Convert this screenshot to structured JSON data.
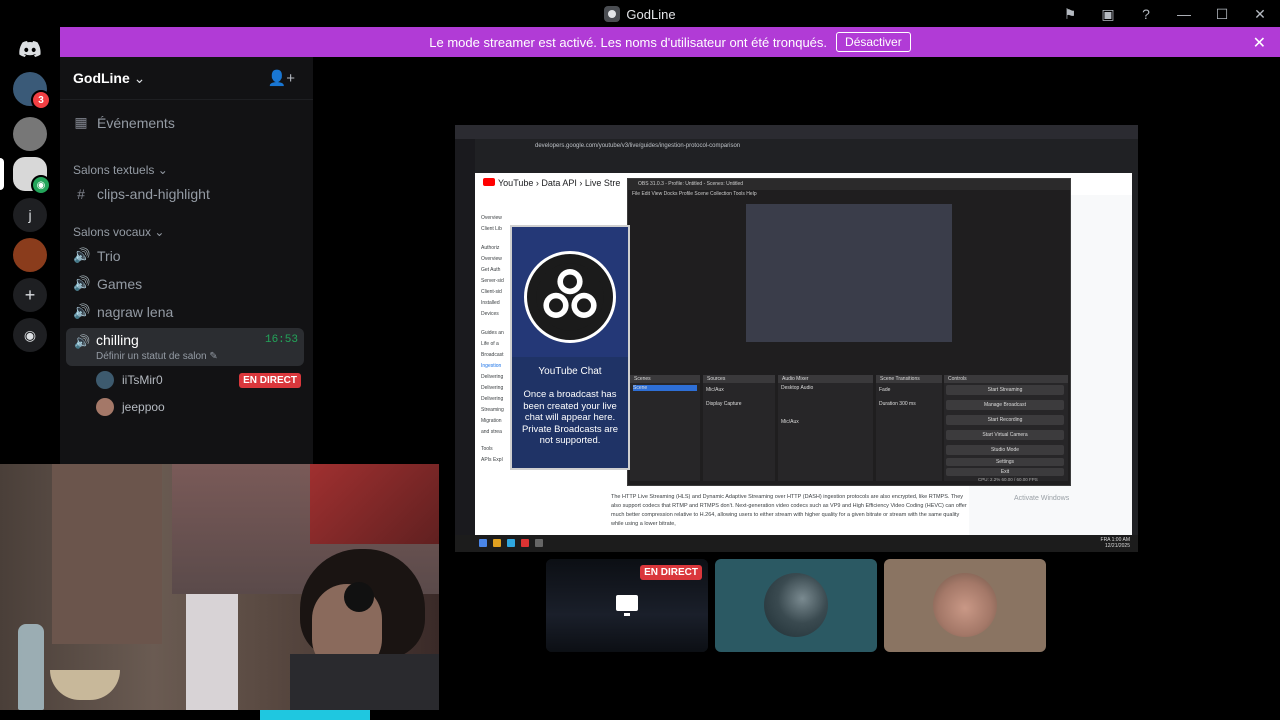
{
  "app": {
    "title": "GodLine"
  },
  "titlebar_icons": [
    "inbox-flag-icon",
    "monitor-icon",
    "help-icon",
    "minimize-icon",
    "maximize-icon",
    "close-icon"
  ],
  "server_rail": {
    "items": [
      {
        "name": "discord-home",
        "badge": ""
      },
      {
        "name": "server-1",
        "badge": "3"
      },
      {
        "name": "server-2",
        "badge": ""
      },
      {
        "name": "server-godline",
        "badge": ""
      },
      {
        "name": "server-j",
        "label": "j",
        "badge": ""
      },
      {
        "name": "server-5",
        "badge": ""
      },
      {
        "name": "add-server",
        "badge": ""
      },
      {
        "name": "discover",
        "badge": ""
      }
    ]
  },
  "banner": {
    "text": "Le mode streamer est activé. Les noms d'utilisateur ont été tronqués.",
    "button": "Désactiver"
  },
  "guild": {
    "name": "GodLine"
  },
  "channels": {
    "events": "Événements",
    "text_category": "Salons textuels",
    "text_channels": [
      "clips-and-highlight"
    ],
    "voice_category": "Salons vocaux",
    "voice_channels": [
      "Trio",
      "Games",
      "nagraw lena"
    ],
    "active": {
      "name": "chilling",
      "time": "16:53",
      "status": "Définir un statut de salon"
    },
    "users": [
      {
        "name": "iiTsMir0",
        "live": "EN DIRECT"
      },
      {
        "name": "jeeppoo",
        "live": ""
      }
    ]
  },
  "screen_share": {
    "browser_url": "developers.google.com/youtube/v3/live/guides/ingestion-protocol-comparison",
    "youtube_breadcrumb": "YouTube › Data API › Live Stre",
    "docs_nav": [
      "Overview",
      "Client Lib",
      "Authoriz",
      "Overview",
      "Get Auth",
      "Server-sid",
      "Client-sid",
      "Installed",
      "Devices",
      "Guides an",
      "Life of a",
      "Broadcast",
      "Ingestion",
      "Delivering",
      "Delivering",
      "Delivering",
      "Streaming",
      "Migration and strea",
      "Tools",
      "APIs Expl"
    ],
    "doc_paragraph": "The HTTP Live Streaming (HLS) and Dynamic Adaptive Streaming over HTTP (DASH) ingestion protocols are also encrypted, like RTMPS. They also support codecs that RTMP and RTMPS don't. Next-generation video codecs such as VP9 and High Efficiency Video Coding (HEVC) can offer much better compression relative to H.264, allowing users to either stream with higher quality for a given bitrate or stream with the same quality while using a lower bitrate,",
    "obs": {
      "title": "OBS 31.0.3 - Profile: Untitled - Scenes: Untitled",
      "menu": "File  Edit  View  Docks  Profile  Scene Collection  Tools  Help",
      "docks": [
        "Scenes",
        "Sources",
        "Audio Mixer",
        "Scene Transitions",
        "Controls"
      ],
      "scene": "Scene",
      "sources": [
        "Mic/Aux",
        "Display Capture"
      ],
      "mixer": [
        "Desktop Audio",
        "Mic/Aux"
      ],
      "transition": "Fade",
      "duration_label": "Duration",
      "duration": "300 ms",
      "controls": [
        "Start Streaming",
        "Manage Broadcast",
        "Start Recording",
        "Start Virtual Camera",
        "Studio Mode",
        "Settings",
        "Exit"
      ],
      "status": "CPU: 2.2%  60.00 / 60.00 FPS"
    },
    "youtube_chat": {
      "title": "YouTube Chat",
      "message": "Once a broadcast has been created your live chat will appear here. Private Broadcasts are not supported."
    },
    "taskbar": {
      "lang": "FRA",
      "time": "1:00 AM",
      "date": "12/21/2025"
    },
    "watermark": "Activate Windows"
  },
  "tiles": [
    {
      "name": "screen-share-tile",
      "live": "EN DIRECT"
    },
    {
      "name": "user-tile-2",
      "live": ""
    },
    {
      "name": "user-tile-3",
      "live": ""
    }
  ]
}
